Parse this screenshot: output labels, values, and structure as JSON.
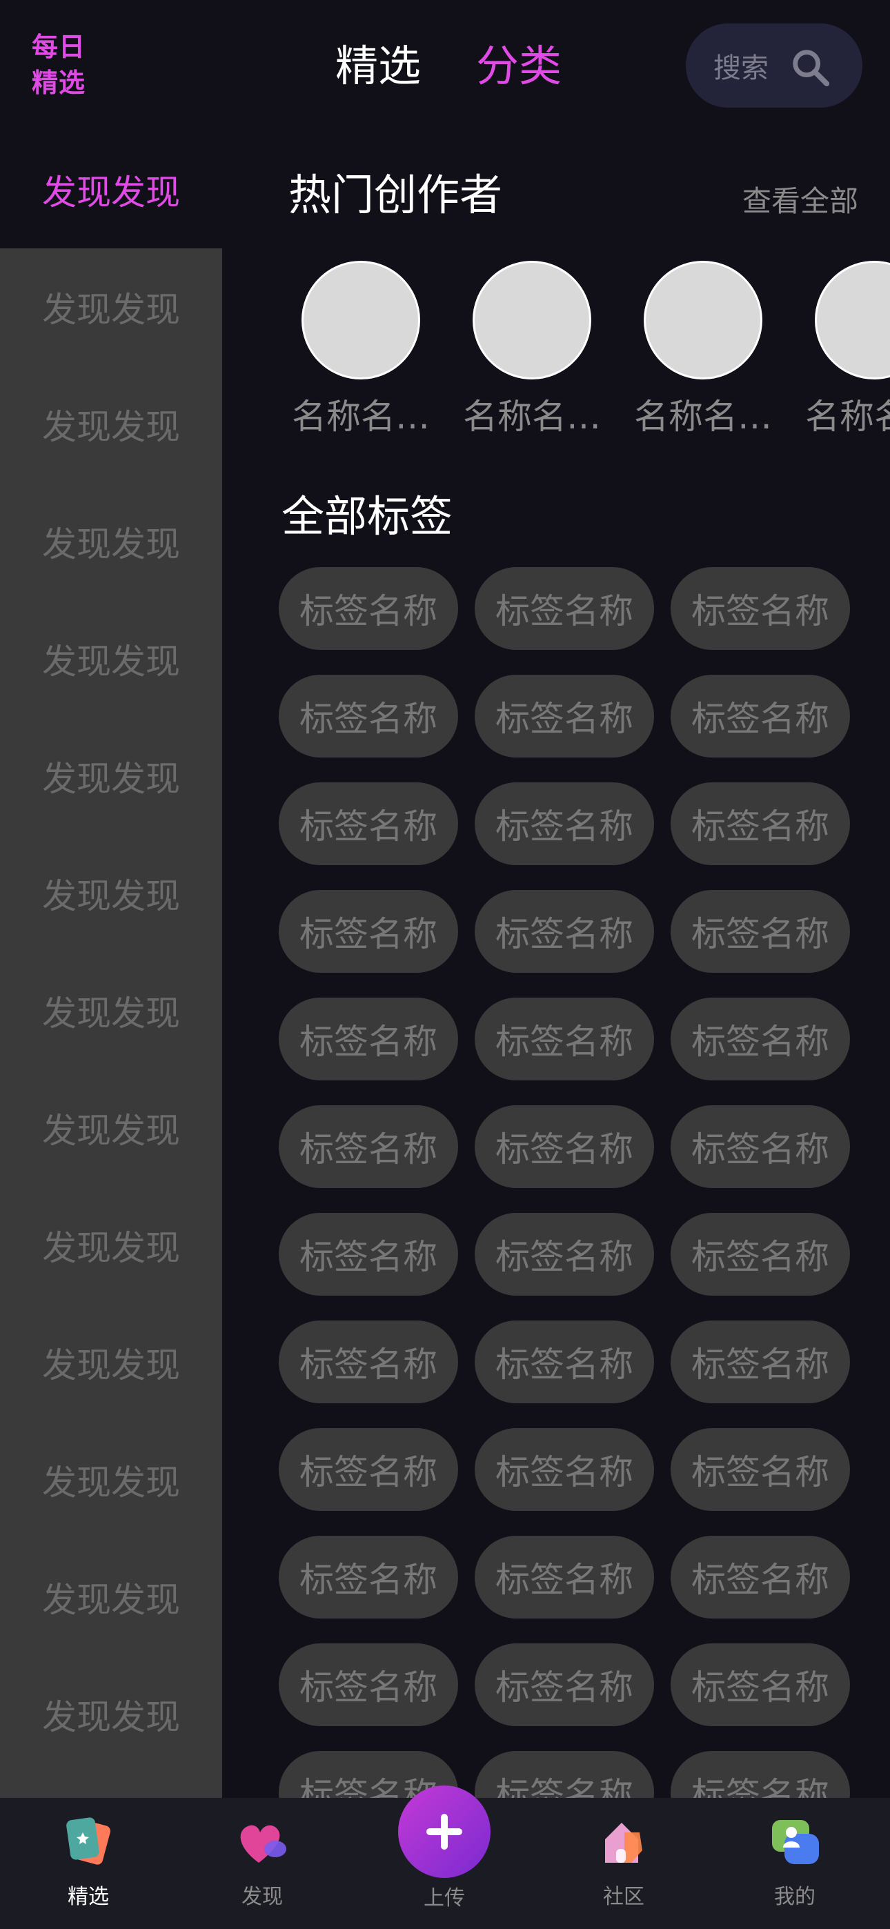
{
  "header": {
    "logo_line1": "每日",
    "logo_line2": "精选",
    "tabs": [
      {
        "label": "精选",
        "active": false
      },
      {
        "label": "分类",
        "active": true
      }
    ],
    "search": {
      "placeholder": "搜索",
      "icon": "search-icon"
    }
  },
  "sidebar": {
    "items": [
      {
        "label": "发现发现",
        "active": true
      },
      {
        "label": "发现发现",
        "active": false
      },
      {
        "label": "发现发现",
        "active": false
      },
      {
        "label": "发现发现",
        "active": false
      },
      {
        "label": "发现发现",
        "active": false
      },
      {
        "label": "发现发现",
        "active": false
      },
      {
        "label": "发现发现",
        "active": false
      },
      {
        "label": "发现发现",
        "active": false
      },
      {
        "label": "发现发现",
        "active": false
      },
      {
        "label": "发现发现",
        "active": false
      },
      {
        "label": "发现发现",
        "active": false
      },
      {
        "label": "发现发现",
        "active": false
      },
      {
        "label": "发现发现",
        "active": false
      },
      {
        "label": "发现发现",
        "active": false
      }
    ]
  },
  "creators_section": {
    "title": "热门创作者",
    "view_all": "查看全部",
    "creators": [
      {
        "name": "名称名…"
      },
      {
        "name": "名称名…"
      },
      {
        "name": "名称名…"
      },
      {
        "name": "名称名…"
      }
    ]
  },
  "tags_section": {
    "title": "全部标签",
    "tags": [
      "标签名称",
      "标签名称",
      "标签名称",
      "标签名称",
      "标签名称",
      "标签名称",
      "标签名称",
      "标签名称",
      "标签名称",
      "标签名称",
      "标签名称",
      "标签名称",
      "标签名称",
      "标签名称",
      "标签名称",
      "标签名称",
      "标签名称",
      "标签名称",
      "标签名称",
      "标签名称",
      "标签名称",
      "标签名称",
      "标签名称",
      "标签名称",
      "标签名称",
      "标签名称",
      "标签名称",
      "标签名称",
      "标签名称",
      "标签名称",
      "标签名称",
      "标签名称",
      "标签名称",
      "标签名称",
      "标签名称",
      "标签名称"
    ]
  },
  "bottom_nav": {
    "items": [
      {
        "label": "精选",
        "icon": "cards-icon",
        "active": true
      },
      {
        "label": "发现",
        "icon": "heart-icon",
        "active": false
      },
      {
        "label": "上传",
        "icon": "plus-icon",
        "active": false
      },
      {
        "label": "社区",
        "icon": "house-icon",
        "active": false
      },
      {
        "label": "我的",
        "icon": "profile-chat-icon",
        "active": false
      }
    ]
  },
  "colors": {
    "accent": "#e04be6",
    "background": "#111019",
    "sidebar": "#3a3a3a",
    "tag_pill": "#3a3a3a"
  }
}
